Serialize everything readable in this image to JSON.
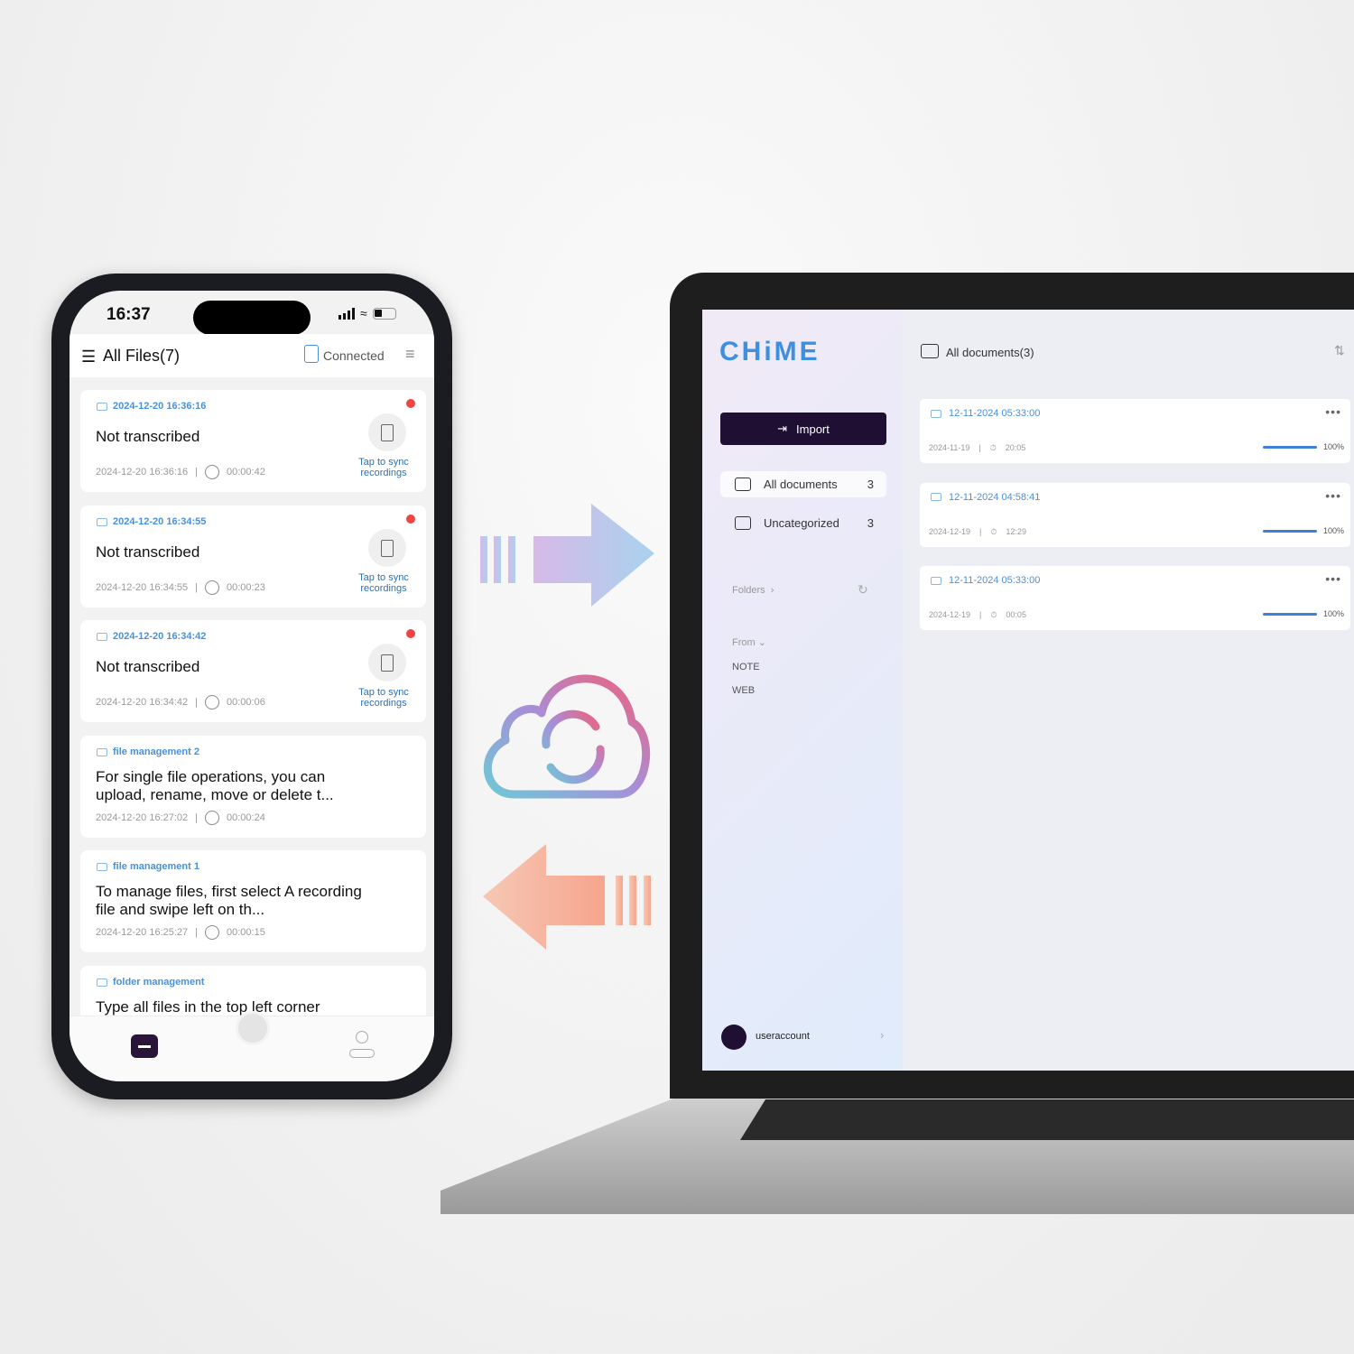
{
  "phone": {
    "time": "16:37",
    "title": "All Files(7)",
    "connected": "Connected",
    "sync_label": "Tap to sync recordings",
    "files": [
      {
        "tag": "2024-12-20 16:36:16",
        "title": "Not transcribed",
        "date": "2024-12-20 16:36:16",
        "duration": "00:00:42",
        "unsynced": true
      },
      {
        "tag": "2024-12-20 16:34:55",
        "title": "Not transcribed",
        "date": "2024-12-20 16:34:55",
        "duration": "00:00:23",
        "unsynced": true
      },
      {
        "tag": "2024-12-20 16:34:42",
        "title": "Not transcribed",
        "date": "2024-12-20 16:34:42",
        "duration": "00:00:06",
        "unsynced": true
      },
      {
        "tag": "file management 2",
        "title": "For single file operations, you can upload, rename, move or delete t...",
        "date": "2024-12-20 16:27:02",
        "duration": "00:00:24"
      },
      {
        "tag": "file management 1",
        "title": "To manage files, first select A recording file and swipe left on th...",
        "date": "2024-12-20 16:25:27",
        "duration": "00:00:15"
      },
      {
        "tag": "folder management",
        "title": "Type all files in the top left corner"
      }
    ]
  },
  "desktop": {
    "logo": "CHiME",
    "import": "Import",
    "nav": [
      {
        "label": "All documents",
        "count": "3"
      },
      {
        "label": "Uncategorized",
        "count": "3"
      }
    ],
    "folders": "Folders",
    "from": "From",
    "sources": [
      "NOTE",
      "WEB"
    ],
    "user": "useraccount",
    "header": "All documents(3)",
    "docs": [
      {
        "title": "12-11-2024 05:33:00",
        "date": "2024-11-19",
        "duration": "20:05",
        "progress": "100%"
      },
      {
        "title": "12-11-2024 04:58:41",
        "date": "2024-12-19",
        "duration": "12:29",
        "progress": "100%"
      },
      {
        "title": "12-11-2024 05:33:00",
        "date": "2024-12-19",
        "duration": "00:05",
        "progress": "100%"
      }
    ]
  },
  "colors": {
    "accent": "#4a90d9",
    "dark": "#1e0f33",
    "unsynced": "#ef4444"
  }
}
